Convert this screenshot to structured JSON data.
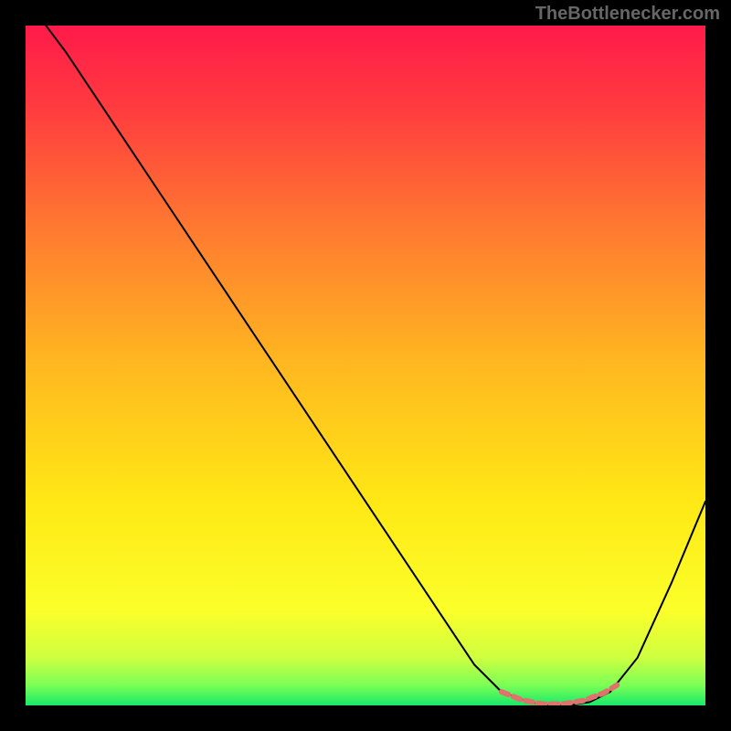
{
  "watermark": "TheBottlenecker.com",
  "chart_data": {
    "type": "line",
    "title": "",
    "xlabel": "",
    "ylabel": "",
    "xlim": [
      0,
      100
    ],
    "ylim": [
      0,
      100
    ],
    "background_gradient": {
      "stops": [
        {
          "offset": 0.0,
          "color": "#ff1a4a"
        },
        {
          "offset": 0.12,
          "color": "#ff3b3f"
        },
        {
          "offset": 0.3,
          "color": "#ff7a30"
        },
        {
          "offset": 0.5,
          "color": "#ffb820"
        },
        {
          "offset": 0.7,
          "color": "#ffe815"
        },
        {
          "offset": 0.86,
          "color": "#fbff2a"
        },
        {
          "offset": 0.93,
          "color": "#ceff40"
        },
        {
          "offset": 0.97,
          "color": "#7cff55"
        },
        {
          "offset": 1.0,
          "color": "#18e86a"
        }
      ]
    },
    "series": [
      {
        "name": "main-curve",
        "color": "#000000",
        "width": 2,
        "x": [
          3,
          6,
          10,
          15,
          20,
          30,
          40,
          50,
          60,
          66,
          70,
          74,
          77,
          80,
          83,
          86,
          90,
          95,
          100
        ],
        "y": [
          100,
          96,
          90,
          82.5,
          75,
          60,
          45,
          30,
          15,
          6,
          2,
          0.5,
          0,
          0,
          0.5,
          2,
          7,
          18,
          30
        ]
      },
      {
        "name": "highlight-segment",
        "color": "#e0726e",
        "width": 6,
        "dash": "8,6",
        "x": [
          70,
          73,
          76,
          79,
          82,
          85,
          87
        ],
        "y": [
          2.0,
          0.8,
          0.2,
          0.2,
          0.7,
          1.8,
          3.0
        ]
      }
    ]
  }
}
